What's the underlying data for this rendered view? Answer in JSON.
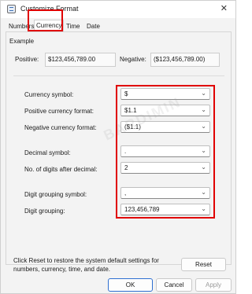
{
  "window": {
    "title": "Customize Format",
    "close_glyph": "✕"
  },
  "tabs": [
    {
      "label": "Numbers"
    },
    {
      "label": "Currency"
    },
    {
      "label": "Time"
    },
    {
      "label": "Date"
    }
  ],
  "example": {
    "heading": "Example",
    "positive_label": "Positive:",
    "positive_value": "$123,456,789.00",
    "negative_label": "Negative:",
    "negative_value": "($123,456,789.00)"
  },
  "fields": {
    "currency_symbol": {
      "label": "Currency symbol:",
      "value": "$"
    },
    "positive_format": {
      "label": "Positive currency format:",
      "value": "$1.1"
    },
    "negative_format": {
      "label": "Negative currency format:",
      "value": "($1.1)"
    },
    "decimal_symbol": {
      "label": "Decimal symbol:",
      "value": "."
    },
    "digits_after_decimal": {
      "label": "No. of digits after decimal:",
      "value": "2"
    },
    "grouping_symbol": {
      "label": "Digit grouping symbol:",
      "value": ","
    },
    "digit_grouping": {
      "label": "Digit grouping:",
      "value": "123,456,789"
    }
  },
  "footer": {
    "note": "Click Reset to restore the system default settings for numbers, currency, time, and date.",
    "reset_label": "Reset",
    "ok_label": "OK",
    "cancel_label": "Cancel",
    "apply_label": "Apply"
  },
  "colors": {
    "highlight": "#e00000",
    "primary_border": "#2f6fd1"
  },
  "watermark": "BARDIMIN"
}
